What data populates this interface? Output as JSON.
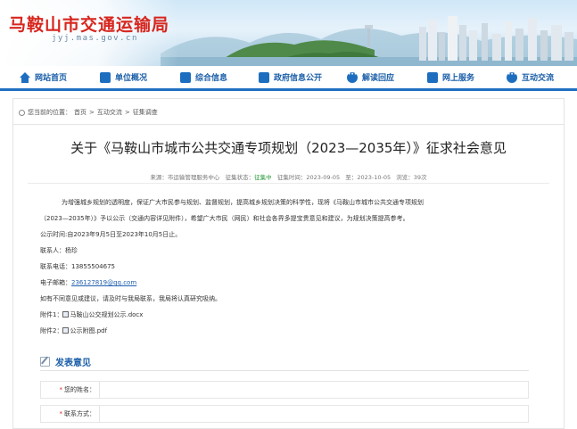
{
  "header": {
    "site_title": "马鞍山市交通运输局",
    "site_url": "jyj.mas.gov.cn"
  },
  "nav": {
    "items": [
      {
        "label": "网站首页",
        "icon": "home-icon"
      },
      {
        "label": "单位概况",
        "icon": "building-icon"
      },
      {
        "label": "综合信息",
        "icon": "info-icon"
      },
      {
        "label": "政府信息公开",
        "icon": "document-icon"
      },
      {
        "label": "解读回应",
        "icon": "chat-icon"
      },
      {
        "label": "网上服务",
        "icon": "service-icon"
      },
      {
        "label": "互动交流",
        "icon": "chat-icon"
      }
    ]
  },
  "breadcrumb": {
    "prefix": "您当前的位置：",
    "items": [
      "首页",
      "互动交流",
      "征集调查"
    ],
    "separator": ">"
  },
  "article": {
    "title": "关于《马鞍山市城市公共交通专项规划（2023—2035年）》征求社会意见",
    "meta": {
      "source_label": "来源：",
      "source": "市运输管理服务中心",
      "status_label": "征集状态：",
      "status": "征集中",
      "start_label": "征集时间：",
      "start": "2023-09-05",
      "end_label": "至：",
      "end": "2023-10-05",
      "views_label": "浏览：",
      "views": "39次"
    },
    "paragraph_1": "为增强城乡规划的透明度，保证广大市民参与规划、监督规划，提高城乡规划决策的科学性，现将《马鞍山市城市公共交通专项规划",
    "paragraph_1b": "（2023—2035年）》予以公示（交通内容详见附件），希望广大市民（网民）和社会各界多提宝贵意见和建议，为规划决策提高参考。",
    "publicity_time": "公示时间:自2023年9月5日至2023年10月5日止。",
    "contact_label": "联系人：",
    "contact": "杨珍",
    "phone_label": "联系电话：",
    "phone": "13855504675",
    "email_label": "电子邮箱：",
    "email": "236127819@qq.com",
    "closing": "如有不同意见或建议，请及时与我局联系，我局将认真研究吸纳。",
    "attachment_1_label": "附件1：",
    "attachment_1": "马鞍山公交规划公示.docx",
    "attachment_2_label": "附件2：",
    "attachment_2": "公示附图.pdf"
  },
  "comment_form": {
    "heading": "发表意见",
    "fields": [
      {
        "label": "您的姓名：",
        "required_mark": "*",
        "value": ""
      },
      {
        "label": "联系方式：",
        "required_mark": "*",
        "value": ""
      }
    ]
  },
  "colors": {
    "brand_red": "#d7261e",
    "nav_blue": "#1a5ea8",
    "status_green": "#2a9a3a"
  }
}
